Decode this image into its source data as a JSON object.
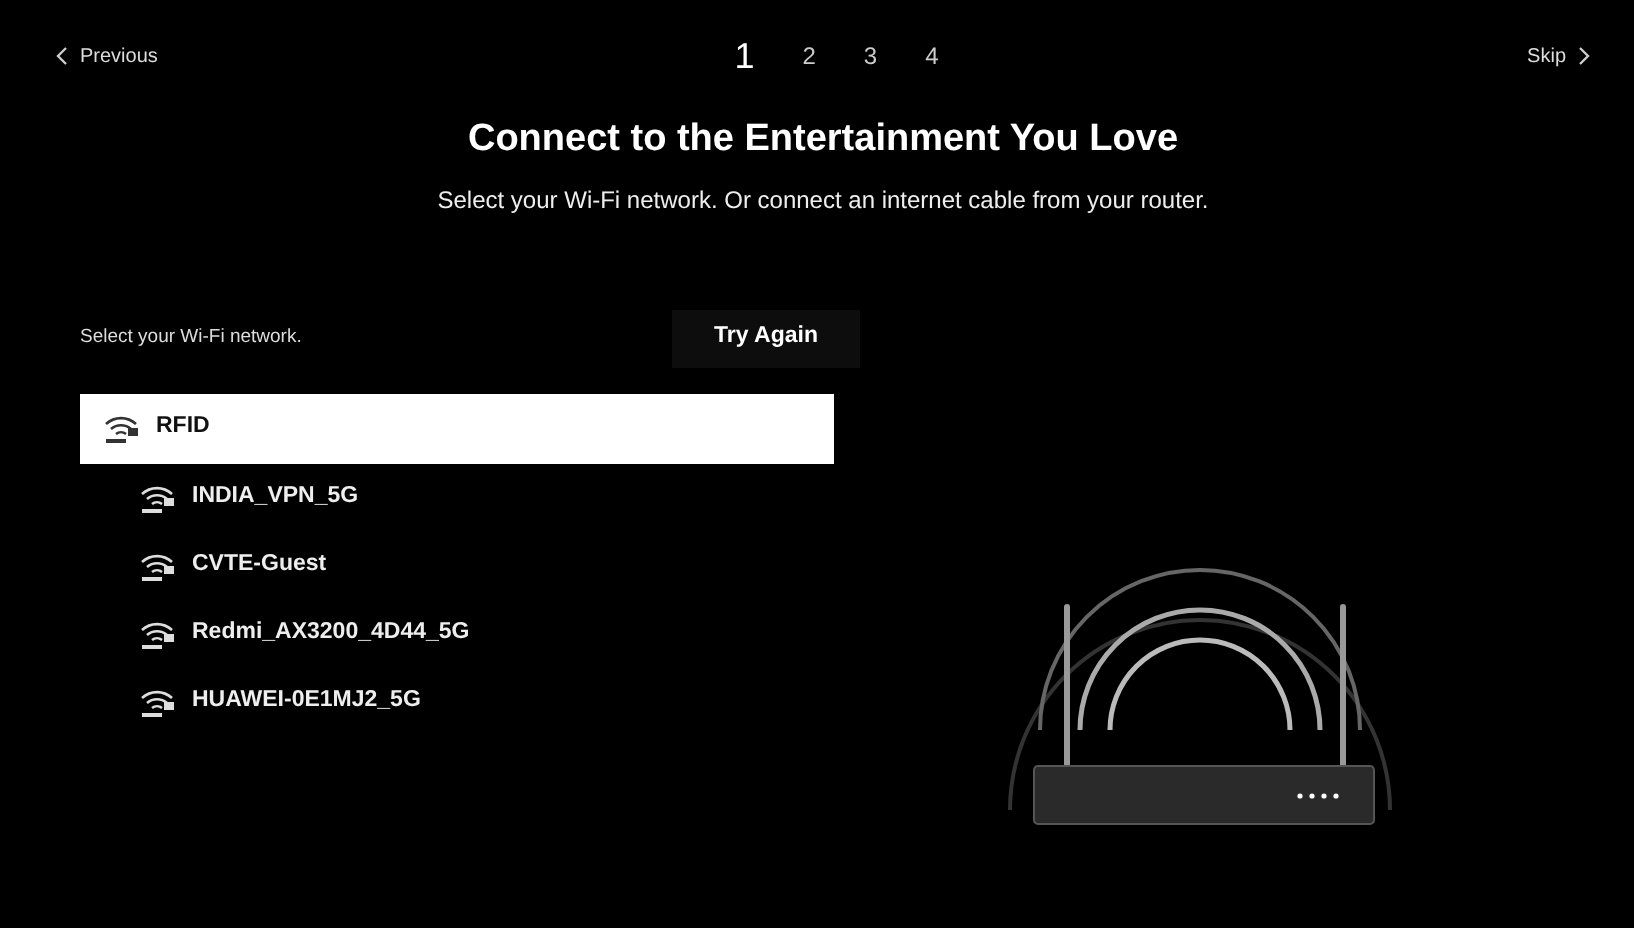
{
  "nav": {
    "previous": "Previous",
    "skip": "Skip"
  },
  "steps": [
    {
      "label": "1",
      "selected": true
    },
    {
      "label": "2",
      "selected": false
    },
    {
      "label": "3",
      "selected": false
    },
    {
      "label": "4",
      "selected": false
    }
  ],
  "title": "Connect to the Entertainment You Love",
  "subtitle": "Select your Wi-Fi network. Or connect an internet cable from your router.",
  "network_prompt": "Select your Wi-Fi network.",
  "try_again": "Try Again",
  "networks": [
    {
      "name": "RFID",
      "selected": true
    },
    {
      "name": "INDIA_VPN_5G",
      "selected": false
    },
    {
      "name": "CVTE-Guest",
      "selected": false
    },
    {
      "name": "Redmi_AX3200_4D44_5G",
      "selected": false
    },
    {
      "name": "HUAWEI-0E1MJ2_5G",
      "selected": false
    }
  ]
}
